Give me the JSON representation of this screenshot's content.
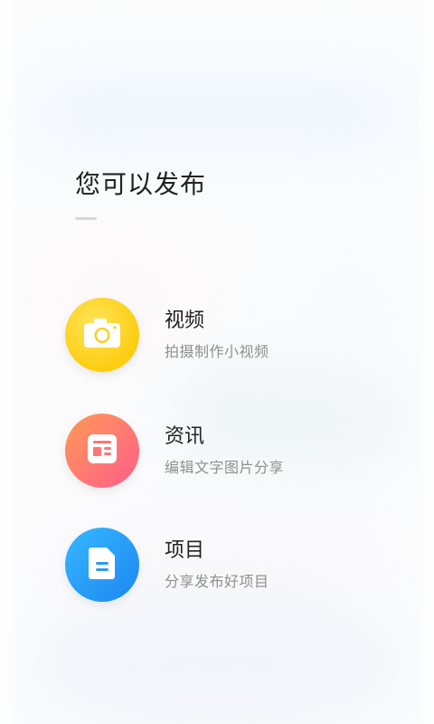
{
  "page": {
    "title": "您可以发布"
  },
  "options": [
    {
      "id": "video",
      "title": "视频",
      "subtitle": "拍摄制作小视频",
      "icon": "camera-icon",
      "color": "#FDCD10"
    },
    {
      "id": "news",
      "title": "资讯",
      "subtitle": "编辑文字图片分享",
      "icon": "article-icon",
      "color": "#FF6E7A"
    },
    {
      "id": "project",
      "title": "项目",
      "subtitle": "分享发布好项目",
      "icon": "document-icon",
      "color": "#2A9BF6"
    }
  ]
}
